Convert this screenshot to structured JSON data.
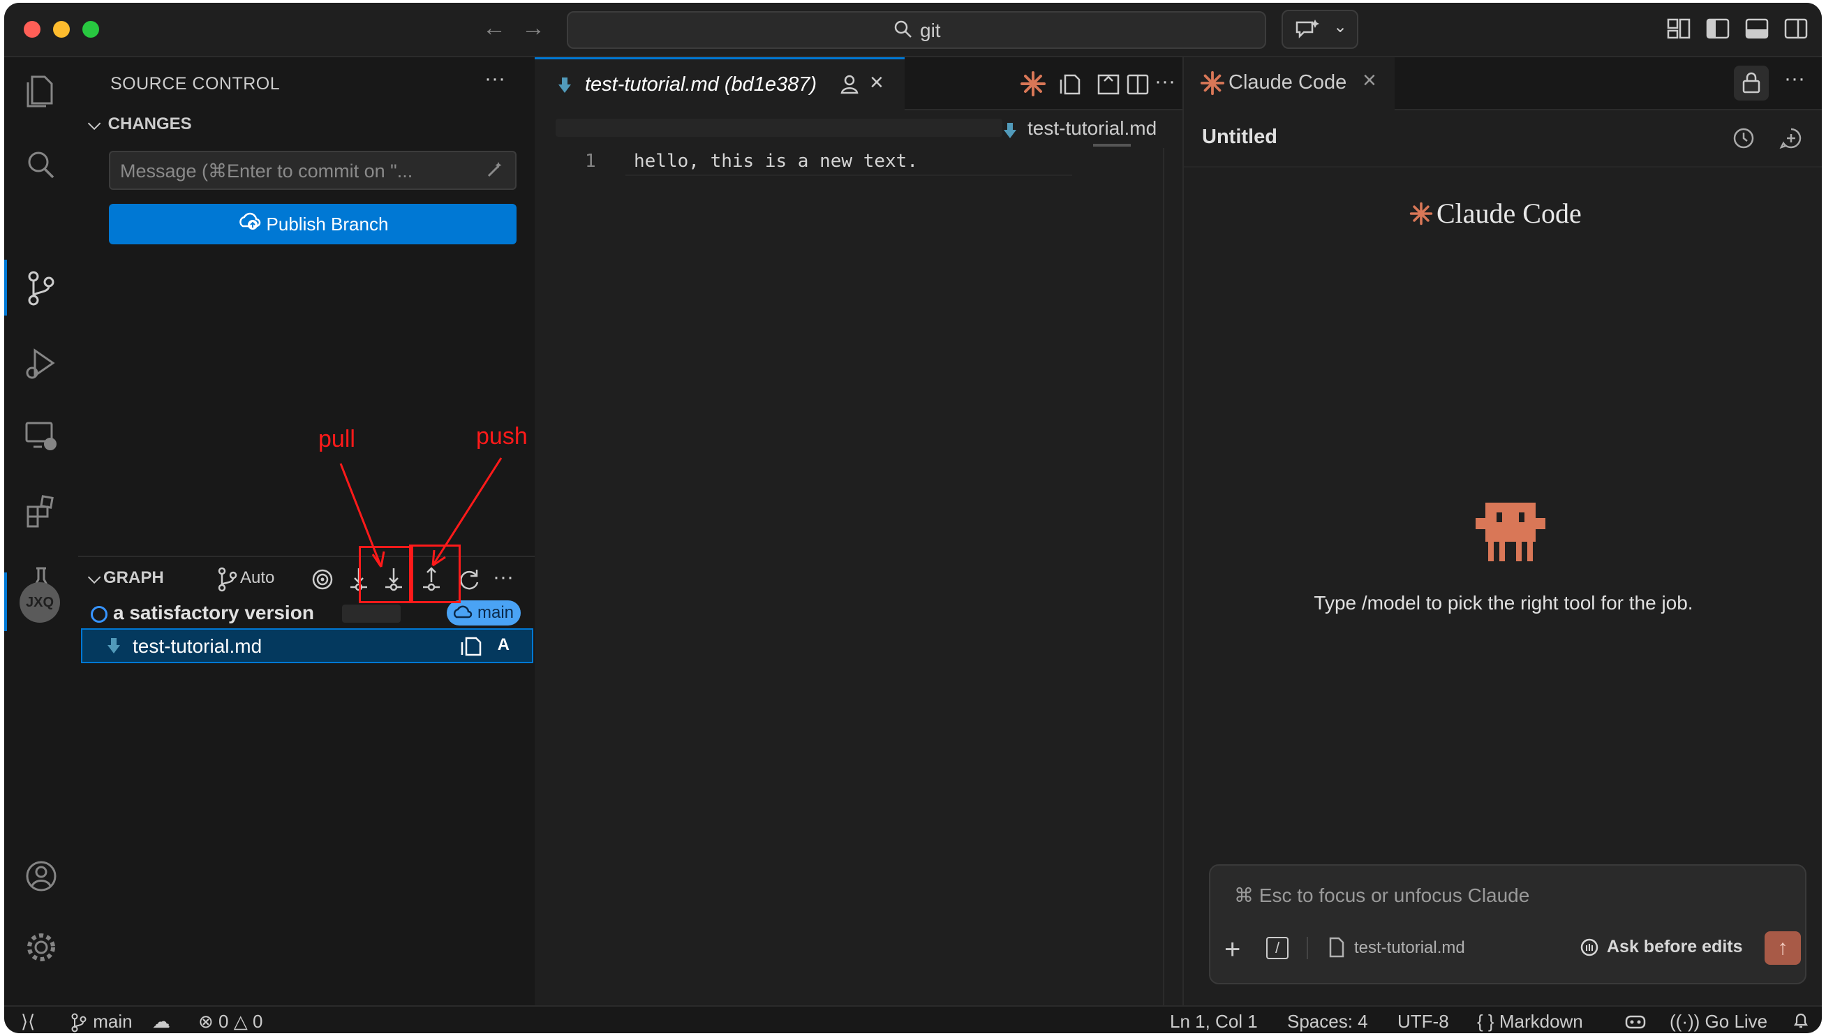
{
  "search": {
    "text": "git"
  },
  "activity": {
    "items": [
      "explorer",
      "search",
      "source-control",
      "run-debug",
      "remote-explorer",
      "extensions",
      "testing",
      "jxq"
    ],
    "account_label": "JXQ"
  },
  "sidebar": {
    "title": "SOURCE CONTROL",
    "more": "···",
    "changes_label": "CHANGES",
    "message_placeholder": "Message (⌘Enter to commit on \"...",
    "publish_label": "Publish Branch",
    "graph_label": "GRAPH",
    "auto_label": "Auto",
    "commit": {
      "message": "a satisfactory version",
      "branch": "main"
    },
    "file": {
      "name": "test-tutorial.md",
      "status": "A"
    }
  },
  "annotations": {
    "pull": "pull",
    "push": "push",
    "color": "#ff1a1a"
  },
  "editor": {
    "tab_title": "test-tutorial.md (bd1e387)",
    "breadcrumb_file": "test-tutorial.md",
    "line_number": "1",
    "code": "hello, this is a new text."
  },
  "claude": {
    "tab_title": "Claude Code",
    "session_title": "Untitled",
    "logo_text": "Claude Code",
    "hint": "Type /model to pick the right tool for the job.",
    "input_placeholder": "⌘ Esc to focus or unfocus Claude",
    "attached_file": "test-tutorial.md",
    "mode_label": "Ask before edits",
    "accent": "#d97757"
  },
  "statusbar": {
    "branch": "main",
    "errors": "0",
    "warnings": "0",
    "position": "Ln 1, Col 1",
    "spaces": "Spaces: 4",
    "encoding": "UTF-8",
    "language": "Markdown",
    "golive": "Go Live"
  },
  "colors": {
    "accent_blue": "#0078d4",
    "background": "#181818"
  }
}
